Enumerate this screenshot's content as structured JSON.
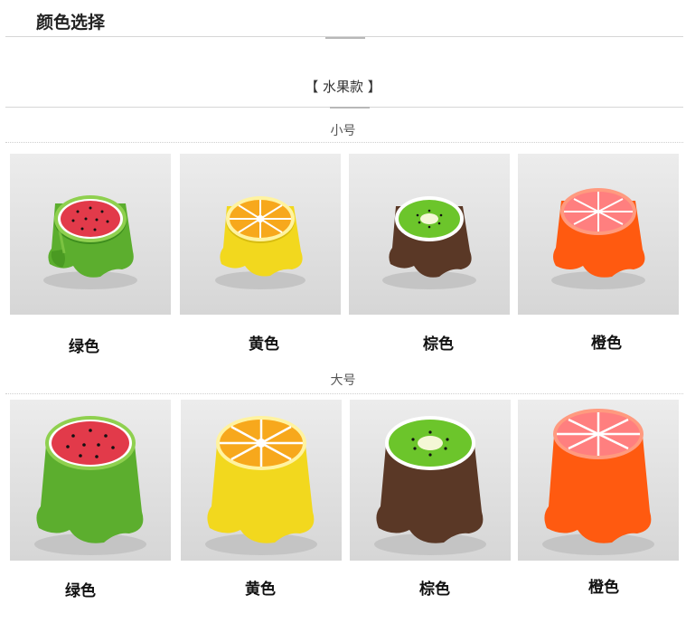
{
  "section": {
    "title": "颜色选择"
  },
  "category": {
    "title": "【 水果款 】"
  },
  "small": {
    "label": "小号",
    "items": [
      {
        "name": "绿色",
        "fruit": "watermelon-icon",
        "body": "#5cae2e",
        "top": "#e23a4a"
      },
      {
        "name": "黄色",
        "fruit": "orange-slice-icon",
        "body": "#f2d81e",
        "top": "#f7a81c"
      },
      {
        "name": "棕色",
        "fruit": "kiwi-icon",
        "body": "#5a3826",
        "top": "#6cc52b"
      },
      {
        "name": "橙色",
        "fruit": "grapefruit-icon",
        "body": "#ff5a10",
        "top": "#ff7f7f"
      }
    ]
  },
  "large": {
    "label": "大号",
    "items": [
      {
        "name": "绿色",
        "fruit": "watermelon-icon",
        "body": "#5cae2e",
        "top": "#e23a4a"
      },
      {
        "name": "黄色",
        "fruit": "orange-slice-icon",
        "body": "#f2d81e",
        "top": "#f7a81c"
      },
      {
        "name": "棕色",
        "fruit": "kiwi-icon",
        "body": "#5a3826",
        "top": "#6cc52b"
      },
      {
        "name": "橙色",
        "fruit": "grapefruit-icon",
        "body": "#ff5a10",
        "top": "#ff7f7f"
      }
    ]
  }
}
